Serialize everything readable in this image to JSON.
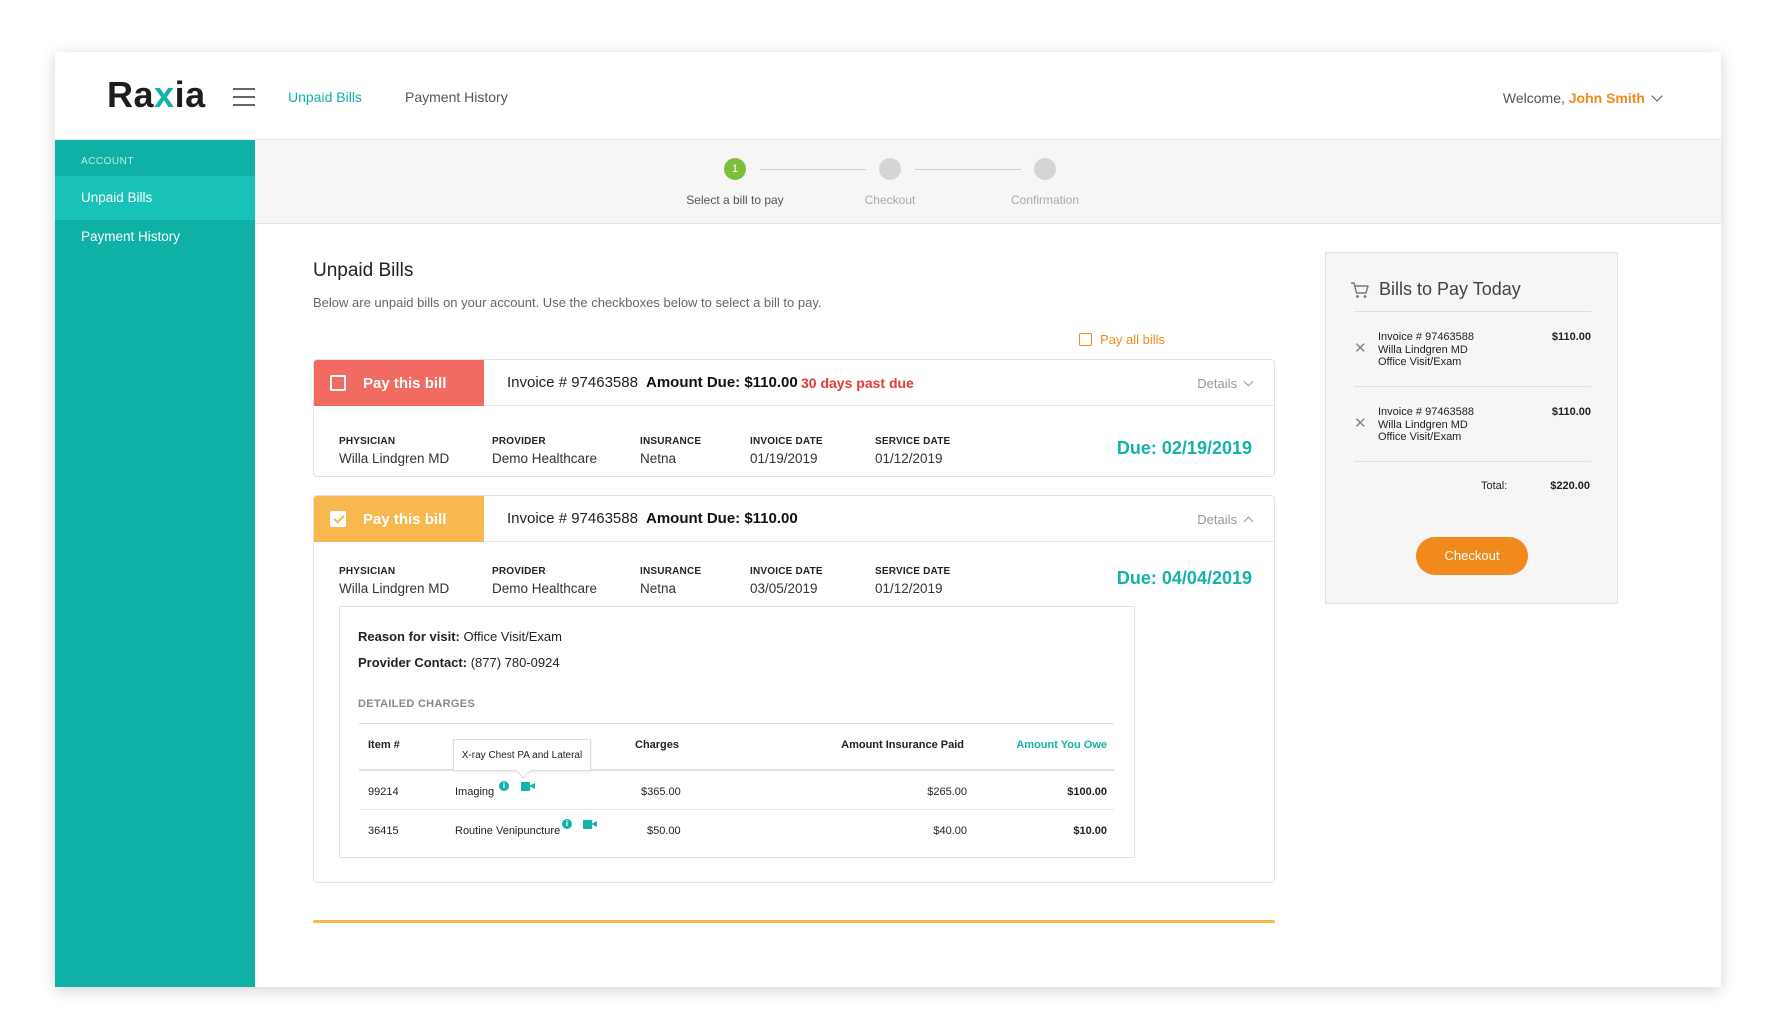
{
  "brand": {
    "logo_pre": "Ra",
    "logo_x": "x",
    "logo_post": "ia"
  },
  "topnav": {
    "unpaid": "Unpaid Bills",
    "history": "Payment History"
  },
  "user": {
    "welcome": "Welcome, ",
    "name": "John Smith"
  },
  "sidebar": {
    "section": "ACCOUNT",
    "items": [
      {
        "label": "Unpaid Bills"
      },
      {
        "label": "Payment History"
      }
    ]
  },
  "stepper": {
    "steps": [
      {
        "number": "1",
        "label": "Select a bill to pay"
      },
      {
        "number": "",
        "label": "Checkout"
      },
      {
        "number": "",
        "label": "Confirmation"
      }
    ]
  },
  "page": {
    "title": "Unpaid Bills",
    "subtitle": "Below are unpaid bills on your account. Use the checkboxes below to select a bill to pay.",
    "pay_all": "Pay all bills"
  },
  "bills": [
    {
      "pay_label": "Pay this bill",
      "invoice": "Invoice # 97463588",
      "amount": "Amount Due: $110.00",
      "past_due": "30 days past due",
      "details": "Details",
      "physician_label": "PHYSICIAN",
      "physician": "Willa Lindgren MD",
      "provider_label": "PROVIDER",
      "provider": "Demo Healthcare",
      "insurance_label": "INSURANCE",
      "insurance": "Netna",
      "invoice_date_label": "INVOICE DATE",
      "invoice_date": "01/19/2019",
      "service_date_label": "SERVICE DATE",
      "service_date": "01/12/2019",
      "due": "Due: 02/19/2019"
    },
    {
      "pay_label": "Pay this bill",
      "invoice": "Invoice # 97463588",
      "amount": "Amount Due: $110.00",
      "details": "Details",
      "physician_label": "PHYSICIAN",
      "physician": "Willa Lindgren MD",
      "provider_label": "PROVIDER",
      "provider": "Demo Healthcare",
      "insurance_label": "INSURANCE",
      "insurance": "Netna",
      "invoice_date_label": "INVOICE DATE",
      "invoice_date": "03/05/2019",
      "service_date_label": "SERVICE DATE",
      "service_date": "01/12/2019",
      "due": "Due: 04/04/2019",
      "reason_label": "Reason for visit:",
      "reason": " Office Visit/Exam",
      "contact_label": "Provider Contact:",
      "contact": " (877) 780-0924",
      "charges_title": "DETAILED CHARGES",
      "tooltip": "X-ray Chest PA and Lateral",
      "headers": {
        "item": "Item #",
        "charges": "Charges",
        "insurance_paid": "Amount Insurance Paid",
        "you_owe": "Amount You Owe"
      },
      "rows": [
        {
          "item": "99214",
          "desc": "Imaging",
          "charges": "$365.00",
          "insurance_paid": "$265.00",
          "you_owe": "$100.00"
        },
        {
          "item": "36415",
          "desc": "Routine Venipuncture",
          "charges": "$50.00",
          "insurance_paid": "$40.00",
          "you_owe": "$10.00"
        }
      ]
    }
  ],
  "cart": {
    "title": "Bills to Pay Today",
    "items": [
      {
        "invoice": "Invoice # 97463588",
        "physician": "Willa Lindgren MD",
        "service": "Office Visit/Exam",
        "price": "$110.00"
      },
      {
        "invoice": "Invoice # 97463588",
        "physician": "Willa Lindgren MD",
        "service": "Office Visit/Exam",
        "price": "$110.00"
      }
    ],
    "total_label": "Total:",
    "total": "$220.00",
    "checkout": "Checkout"
  },
  "colors": {
    "teal": "#12b3a8",
    "orange": "#f08a1c",
    "red": "#f26b62",
    "yellow": "#f7b84f",
    "green": "#7fbe3c"
  }
}
